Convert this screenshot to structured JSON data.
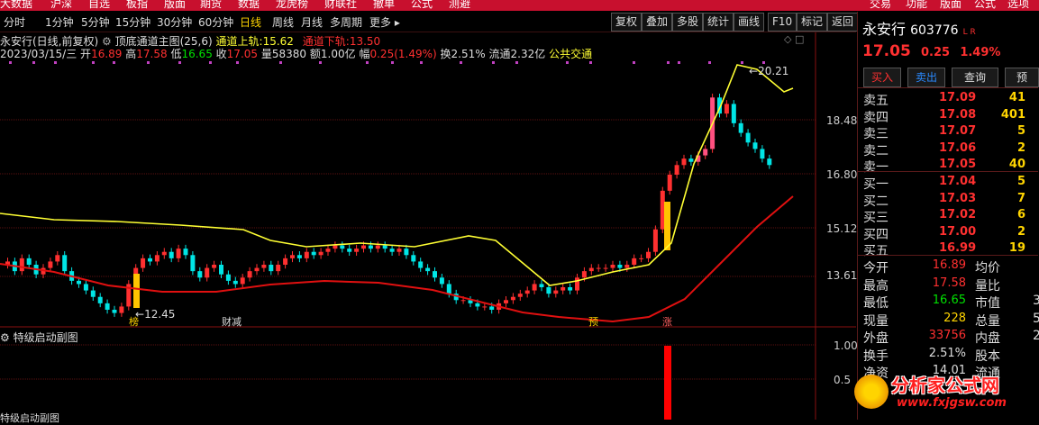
{
  "top_nav": {
    "items": [
      "大数据",
      "沪深",
      "自选",
      "板指",
      "版面",
      "期货",
      "数据",
      "龙虎榜",
      "财联社",
      "撤单",
      "公式",
      "测避"
    ],
    "right_items": [
      "交易",
      "功能",
      "版面",
      "公式",
      "选项"
    ]
  },
  "toolbar": {
    "periods": [
      "分时",
      "1分钟",
      "5分钟",
      "15分钟",
      "30分钟",
      "60分钟",
      "日线",
      "周线",
      "月线",
      "多周期",
      "更多 ▸"
    ],
    "right_buttons": [
      "复权",
      "叠加",
      "多股",
      "统计",
      "画线",
      "F10",
      "标记",
      "返回"
    ]
  },
  "chart": {
    "series_name": "永安行(日线,前复权)",
    "indicator_name": "顶底通道主图(25,6)",
    "upper_label": "通道上轨:",
    "upper_value": "15.62",
    "lower_label": "通道下轨:",
    "lower_value": "13.50",
    "date": "2023/03/15/三",
    "open_label": "开",
    "open_value": "16.89",
    "high_label": "高",
    "high_value": "17.58",
    "low_label": "低",
    "low_value": "16.65",
    "close_label": "收",
    "close_value": "17.05",
    "vol_label": "量",
    "vol_value": "58380",
    "amount_label": "额",
    "amount_value": "1.00亿",
    "change_label": "幅",
    "change_value": "0.25(1.49%)",
    "turnover_label": "换",
    "turnover_value": "2.51%",
    "float_label": "流通",
    "float_value": "2.32亿",
    "sector": "公共交通",
    "price_ticks": [
      "18.48",
      "16.80",
      "15.12",
      "13.61"
    ],
    "high_annotation": "20.21",
    "low_annotation": "12.45",
    "markers": [
      "榜",
      "财减",
      "预",
      "涨"
    ],
    "sub_title": "特级启动副图",
    "sub_ticks": [
      "1.00",
      "0.5"
    ],
    "bottom_label": "特级启动副图"
  },
  "chart_data": {
    "type": "candlestick",
    "yaxis_ticks": [
      13.61,
      15.12,
      16.8,
      18.48
    ],
    "series": [
      {
        "name": "通道上轨",
        "color": "#ffff33"
      },
      {
        "name": "通道下轨",
        "color": "#e01010"
      }
    ],
    "last_candle": {
      "date": "2023/03/15",
      "open": 16.89,
      "high": 17.58,
      "low": 16.65,
      "close": 17.05
    },
    "subchart": {
      "title": "特级启动副图",
      "ylim": [
        0,
        1
      ],
      "signal_value": 1
    }
  },
  "quote": {
    "name": "永安行",
    "code": "603776",
    "flags": "L R",
    "price": "17.05",
    "change": "0.25",
    "pct": "1.49%",
    "buttons": [
      "买入",
      "卖出",
      "查询",
      "预"
    ],
    "asks": [
      {
        "label": "卖五",
        "price": "17.09",
        "vol": "41"
      },
      {
        "label": "卖四",
        "price": "17.08",
        "vol": "401"
      },
      {
        "label": "卖三",
        "price": "17.07",
        "vol": "5"
      },
      {
        "label": "卖二",
        "price": "17.06",
        "vol": "2"
      },
      {
        "label": "卖一",
        "price": "17.05",
        "vol": "40"
      }
    ],
    "bids": [
      {
        "label": "买一",
        "price": "17.04",
        "vol": "5"
      },
      {
        "label": "买二",
        "price": "17.03",
        "vol": "7"
      },
      {
        "label": "买三",
        "price": "17.02",
        "vol": "6"
      },
      {
        "label": "买四",
        "price": "17.00",
        "vol": "2"
      },
      {
        "label": "买五",
        "price": "16.99",
        "vol": "19"
      }
    ],
    "stats": [
      {
        "l": "今开",
        "v": "16.89",
        "l2": "均价",
        "v2": ""
      },
      {
        "l": "最高",
        "v": "17.58",
        "l2": "量比",
        "v2": ""
      },
      {
        "l": "最低",
        "v": "16.65",
        "l2": "市值",
        "v2": "3"
      },
      {
        "l": "现量",
        "v": "228",
        "l2": "总量",
        "v2": "5"
      },
      {
        "l": "外盘",
        "v": "33756",
        "l2": "内盘",
        "v2": "2"
      },
      {
        "l": "换手",
        "v": "2.51%",
        "l2": "股本",
        "v2": ""
      },
      {
        "l": "净资",
        "v": "14.01",
        "l2": "流通",
        "v2": ""
      }
    ]
  },
  "watermark": {
    "title": "分析家公式网",
    "url": "www.fxjgsw.com"
  },
  "colors": {
    "up": "#ff3030",
    "down": "#00e5e5",
    "bg": "#000000",
    "nav": "#c8102e",
    "upper": "#ffff33",
    "lower": "#e01010"
  }
}
